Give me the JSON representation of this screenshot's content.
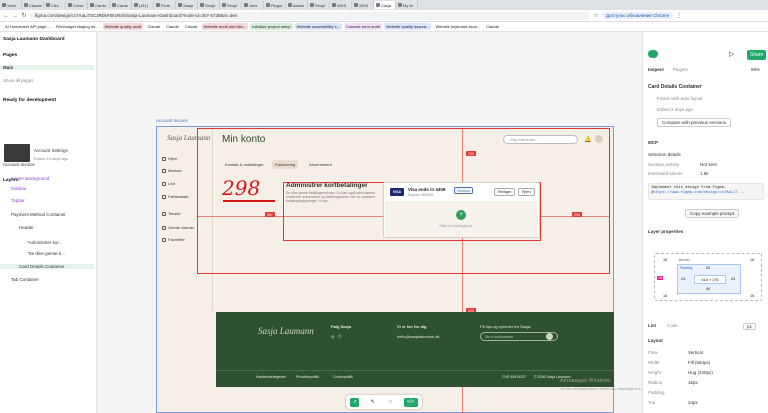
{
  "browser": {
    "tabs": [
      "Vresi",
      "Claude",
      "Clev",
      "Cover",
      "Cardo",
      "Cardo",
      "(411)",
      "Flmb",
      "Sasja",
      "Shopi",
      "Shopi",
      "Jobs",
      "Plugin",
      "dashb",
      "Shopi",
      "WDS",
      "WDS",
      "Sasja",
      "My Ar"
    ],
    "active_tab_index": 17,
    "url": "figma.com/design/cc7AaLi7SC3RbkF8IrcRxh/Sasja-Laumann-Dashboard?node-id=307-6728&m=dev",
    "notice": "Доступно обновление Chrome",
    "bookmarks": [
      {
        "label": "AI Humanizer API page...",
        "color": "#ffffff"
      },
      {
        "label": "Filmbudget staging do...",
        "color": "#ffffff"
      },
      {
        "label": "Website quality audit",
        "color": "#f8d7da"
      },
      {
        "label": "Claude",
        "color": "#ffffff"
      },
      {
        "label": "Claude",
        "color": "#ffffff"
      },
      {
        "label": "Claude",
        "color": "#ffffff"
      },
      {
        "label": "Website audit and site...",
        "color": "#f8d7da"
      },
      {
        "label": "Initialize project setup",
        "color": "#d4f0dc"
      },
      {
        "label": "Website accessibility s...",
        "color": "#dbe5fb"
      },
      {
        "label": "Console error audit",
        "color": "#f3e0fa"
      },
      {
        "label": "Website quality assura...",
        "color": "#dbe5fb"
      },
      {
        "label": "Website keyboard acce...",
        "color": "#ffffff"
      },
      {
        "label": "Claude",
        "color": "#ffffff"
      }
    ]
  },
  "left_panel": {
    "file_title": "Sasja Laumann Dashboard",
    "pages_label": "Pages",
    "current_page": "Main",
    "show_all": "Show all pages",
    "ready_label": "Ready for development",
    "ready_item_title": "Account Settings",
    "ready_item_sub": "Edited 14 days ago",
    "layers_label": "Layers",
    "layers": [
      {
        "label": "Account Invoice",
        "depth": 0,
        "purple": false,
        "selected": false
      },
      {
        "label": "Footer Background",
        "depth": 1,
        "purple": true,
        "selected": false
      },
      {
        "label": "Sidebar",
        "depth": 1,
        "purple": true,
        "selected": false
      },
      {
        "label": "Topbar",
        "depth": 1,
        "purple": true,
        "selected": false
      },
      {
        "label": "Payment Method Container",
        "depth": 1,
        "purple": false,
        "selected": false
      },
      {
        "label": "Header",
        "depth": 2,
        "purple": false,
        "selected": false
      },
      {
        "label": "\"Administrer kor...",
        "depth": 3,
        "purple": false,
        "selected": false
      },
      {
        "label": "\"Se dine gemte k...",
        "depth": 3,
        "purple": false,
        "selected": false
      },
      {
        "label": "Card Details Container",
        "depth": 2,
        "purple": false,
        "selected": true
      },
      {
        "label": "Tab Container",
        "depth": 1,
        "purple": false,
        "selected": false
      }
    ]
  },
  "canvas": {
    "frame_label": "Account Invoice",
    "page_title": "Min konto",
    "search_placeholder": "Søg træninger...",
    "tabs": [
      "Kontakt & Indstillinger",
      "Fakturering",
      "Abonnement"
    ],
    "nav": [
      "Hjem",
      "Øvelser",
      "Live",
      "Fællesskab",
      "Tekster",
      "Gemte videoer",
      "Favoritter"
    ],
    "handwritten": "298",
    "section_title": "Administrer kortbetalinger",
    "section_desc": "Se dine gemte betalingsmetoder. Du kan også administrere relaterede dokumenter og betalingsplaner, når du opdaterer betalingsoplysninger, vi kan...",
    "card_brand": "VISA",
    "card_title": "Visa ends in 4409",
    "card_sub": "Expires 05/2026",
    "card_badge": "Standard",
    "edit_button": "Rediger",
    "remove_button": "Fjern",
    "add_card_text": "Tilføj nyt betalingskort",
    "spacing_labels": [
      "233",
      "857",
      "298",
      "423"
    ],
    "footer": {
      "signature": "Sasja Laumann",
      "follow": "Følg Sasja",
      "contact_head": "Vi er her for dig",
      "email": "hello@sasjalaumann.dk",
      "newsletter_head": "Få tips og nyheder fra Sasja:",
      "newsletter_placeholder": "Din e-mailadresse",
      "links": [
        "Handelsbetingelser",
        "Privatlivspolitik",
        "Cookiepolitik"
      ],
      "cvr": "CVR 44519237",
      "copyright": "© 2026 Sasja Laumann"
    },
    "win_activate_1": "Активация Windows",
    "win_activate_2": "Чтобы активировать Windows, перейдите в раздел \"Параметры\"."
  },
  "right_panel": {
    "inspect_tab": "Inspect",
    "plugins_tab": "Plugins",
    "share_button": "Share",
    "zoom": "59%",
    "node_name": "Card Details Container",
    "frame_note": "Frame with auto layout",
    "edited": "Edited 2 days ago",
    "compare_button": "Compare with previous versions",
    "mcp_label": "MCP",
    "selection_label": "Selection details",
    "session_label": "Session activity",
    "session_value": "Not sent",
    "tokens_label": "Estimated tokens",
    "tokens_value": "1.6k",
    "code_line1": "Implement this design from Figma.",
    "code_line2": "@https://www.figma.com/design/cc7AaLi7...",
    "copy_button": "Copy example prompt",
    "layer_props_label": "Layer properties",
    "border_label": "Border",
    "padding_label": "Padding",
    "box_top": "24",
    "box_left": "24",
    "box_right": "24",
    "box_bottom": "40",
    "box_size": "616 × 176",
    "margin_values": [
      "16",
      "16",
      "16",
      "16",
      "16"
    ],
    "list_tab": "List",
    "code_tab": "Code",
    "unit": "px",
    "layout_label": "Layout",
    "props": [
      {
        "k": "Flow",
        "v": "Vertical"
      },
      {
        "k": "Width",
        "v": "Fill (664px)"
      },
      {
        "k": "Height",
        "v": "Hug (240px)"
      },
      {
        "k": "Radius",
        "v": "16px"
      },
      {
        "k": "Padding",
        "v": ""
      },
      {
        "k": "Top",
        "v": "24px"
      }
    ]
  }
}
